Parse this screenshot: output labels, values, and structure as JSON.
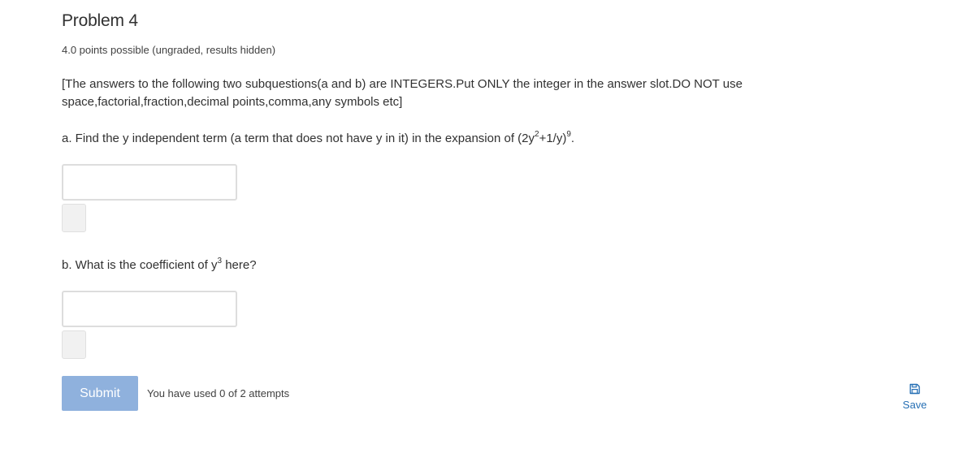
{
  "problem": {
    "title": "Problem 4",
    "points": "4.0 points possible (ungraded, results hidden)",
    "instructions": "[The answers to the following two subquestions(a and b) are INTEGERS.Put ONLY the integer in the answer slot.DO NOT use space,factorial,fraction,decimal points,comma,any symbols etc]"
  },
  "question_a": {
    "text_before": "a. Find the y independent term (a term that does not have y in it) in the expansion of (2y",
    "sup1": "2",
    "text_middle": "+1/y)",
    "sup2": "9",
    "text_after": ".",
    "input_value": ""
  },
  "question_b": {
    "text_before": "b. What is the coefficient of y",
    "sup": "3",
    "text_after": " here?",
    "input_value": ""
  },
  "actions": {
    "submit_label": "Submit",
    "attempts_text": "You have used 0 of 2 attempts",
    "save_label": "Save",
    "save_icon": "floppy-disk-icon"
  },
  "colors": {
    "submit_bg": "#8fb1dd",
    "link": "#2770b5"
  }
}
